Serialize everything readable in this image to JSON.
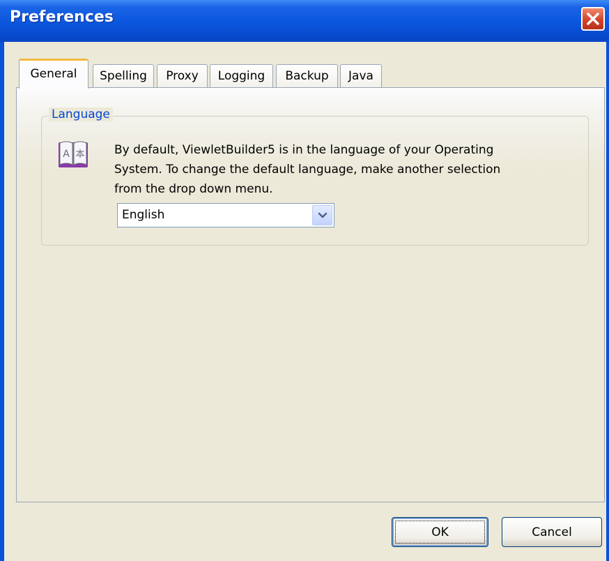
{
  "window": {
    "title": "Preferences"
  },
  "tabs": [
    {
      "label": "General",
      "active": true
    },
    {
      "label": "Spelling",
      "active": false
    },
    {
      "label": "Proxy",
      "active": false
    },
    {
      "label": "Logging",
      "active": false
    },
    {
      "label": "Backup",
      "active": false
    },
    {
      "label": "Java",
      "active": false
    }
  ],
  "language_group": {
    "legend": "Language",
    "description_lines": [
      "By default, ViewletBuilder5 is in the language of your Operating",
      "System. To change the default language, make another selection",
      "from the drop down menu."
    ],
    "icon": "language-book-icon",
    "selected_language": "English"
  },
  "buttons": {
    "ok": "OK",
    "cancel": "Cancel"
  },
  "colors": {
    "titlebar": "#0a55dd",
    "legend_text": "#0046d5",
    "active_tab_accent": "#f5b842",
    "background": "#ece9d8"
  }
}
